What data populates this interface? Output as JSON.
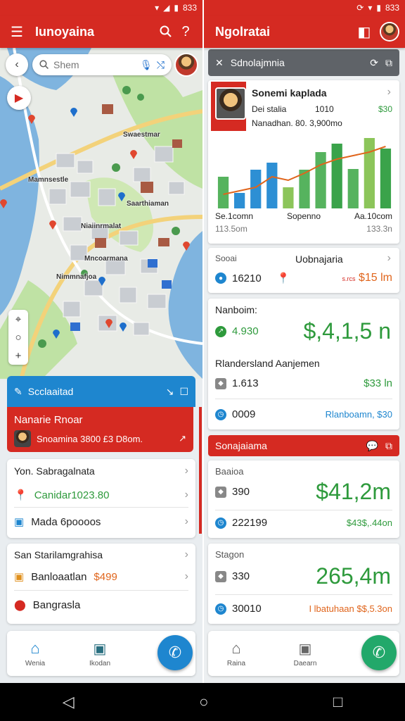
{
  "status": {
    "left_time": "833",
    "right_time": "833"
  },
  "left": {
    "appbar_title": "Iunoyaina",
    "search_placeholder": "Shem",
    "map_labels": [
      "Swaestmar",
      "Mamnsestle",
      "Saarthiaman",
      "Niaiinrmalat",
      "Mncoarmana",
      "Nimmnafjoa"
    ],
    "sheet_title": "Scclaaitad",
    "red_card": {
      "title": "Nanarie Rnoar",
      "subtitle": "Snoamina 3800 £3 D8om."
    },
    "list1": {
      "header": "Yon. Sabragalnata",
      "item1": "Canidar1023.80",
      "item2": "Mada 6poooos"
    },
    "list2": {
      "header": "San Starilamgrahisa",
      "item1_label": "Banloaatlan",
      "item1_value": "$499",
      "item2": "Bangrasla"
    },
    "nav": {
      "item1": "Wenia",
      "item2": "Ikodan"
    }
  },
  "right": {
    "appbar_title": "Ngolratai",
    "subbar_title": "Sdnolajmnia",
    "profile": {
      "name": "Sonemi kaplada",
      "line2_a": "Dei stalia",
      "line2_b": "1010",
      "line2_c": "$30",
      "line3": "Nanadhan. 80. 3,900mo"
    },
    "chart_footer": [
      {
        "label": "Se.1comn",
        "sub": "113.5om"
      },
      {
        "label": "Sopenno",
        "sub": ""
      },
      {
        "label": "Aa.10com",
        "sub": "133.3n"
      }
    ],
    "card2": {
      "label_a": "Sooai",
      "label_b": "Uobnajaria",
      "value": "16210",
      "value2": "$15 lm",
      "value2_prefix": "s.rcs"
    },
    "card3": {
      "header": "Nanboim:",
      "row1": "4.930",
      "big": "$,4,1,5 n",
      "subheader": "Rlandersland Aanjemen",
      "row2_label": "1.613",
      "row2_value": "$33 ln",
      "row3_label": "0009",
      "row3_value": "Rlanboamn, $30"
    },
    "red_bar": "Sonajaiama",
    "card4": {
      "header": "Baaioa",
      "row1": "390",
      "big": "$41,2m",
      "row2": "222199",
      "row2_value": "$43$,.44on"
    },
    "card5": {
      "header": "Stagon",
      "row1": "330",
      "big": "265,4m",
      "row2": "30010",
      "row2_value": "I lbatuhaan $$,5.3on"
    },
    "nav": {
      "item1": "Raina",
      "item2": "Daearn"
    }
  },
  "colors": {
    "red": "#d52a22",
    "blue": "#1e86cf",
    "green": "#2e9a3c",
    "fab_blue": "#1e86cf",
    "fab_green": "#22a86a"
  },
  "chart_data": {
    "type": "bar",
    "categories": [
      "1",
      "2",
      "3",
      "4",
      "5",
      "6",
      "7",
      "8",
      "9",
      "10",
      "11"
    ],
    "values": [
      45,
      22,
      55,
      65,
      30,
      55,
      80,
      92,
      56,
      100,
      85
    ],
    "bar_colors": [
      "#56b35e",
      "#2d8fd4",
      "#2d8fd4",
      "#2d8fd4",
      "#8cc55a",
      "#56b35e",
      "#56b35e",
      "#3aa34a",
      "#56b35e",
      "#8cc55a",
      "#3aa34a"
    ],
    "line": [
      20,
      25,
      30,
      45,
      40,
      50,
      62,
      70,
      75,
      80,
      88
    ],
    "ylim": [
      0,
      110
    ]
  }
}
